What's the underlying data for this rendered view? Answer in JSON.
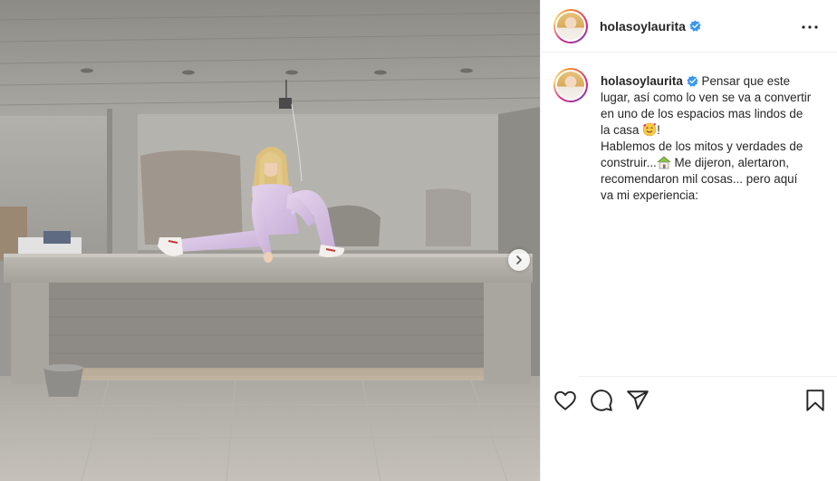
{
  "post": {
    "username": "holasoylaurita",
    "verified": true,
    "caption_lines": [
      "Pensar que este",
      "lugar, así como lo ven se va a convertir",
      "en uno de los espacios mas lindos de",
      "la casa",
      "!",
      "Hablemos de los mitos y verdades de",
      "construir...",
      " Me dijeron, alertaron,",
      "recomendaron mil cosas... pero aquí",
      "va mi experiencia:"
    ]
  },
  "icons": {
    "verified": "verified-badge-icon",
    "more": "more-options-icon",
    "next": "chevron-right-icon",
    "like": "heart-icon",
    "comment": "comment-icon",
    "share": "paper-plane-icon",
    "save": "bookmark-icon",
    "emoji1": "smiling-face-with-hearts-emoji",
    "emoji2": "house-emoji"
  },
  "colors": {
    "verified_blue": "#3897f0",
    "border": "#efefef",
    "text": "#262626"
  }
}
